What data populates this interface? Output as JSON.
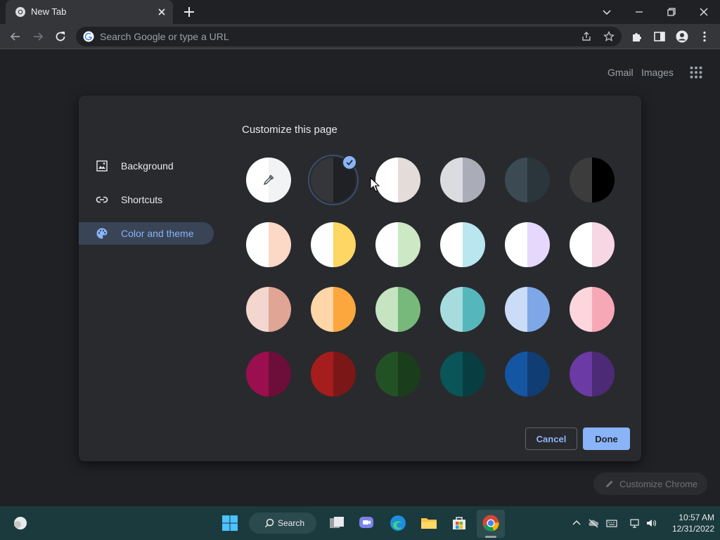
{
  "browser": {
    "tab_title": "New Tab",
    "omnibox_placeholder": "Search Google or type a URL"
  },
  "ntp": {
    "gmail_label": "Gmail",
    "images_label": "Images",
    "customize_chrome_label": "Customize Chrome"
  },
  "dialog": {
    "title": "Customize this page",
    "sidebar": [
      {
        "label": "Background",
        "icon": "image-icon"
      },
      {
        "label": "Shortcuts",
        "icon": "link-icon"
      },
      {
        "label": "Color and theme",
        "icon": "palette-icon",
        "active": true
      }
    ],
    "selected_theme_index": 1,
    "themes": [
      {
        "name": "custom-color-picker",
        "left": "#ffffff",
        "right": "#f1f3f4"
      },
      {
        "name": "default-dark",
        "left": "#35363a",
        "right": "#202124"
      },
      {
        "name": "warm-grey",
        "left": "#ffffff",
        "right": "#e3dcd9"
      },
      {
        "name": "cool-grey",
        "left": "#dadce0",
        "right": "#aaadb7"
      },
      {
        "name": "dark-blue-grey",
        "left": "#3c4a54",
        "right": "#2a353c"
      },
      {
        "name": "black",
        "left": "#3c3c3c",
        "right": "#000000"
      },
      {
        "name": "beige-white",
        "left": "#ffffff",
        "right": "#fcd8c6"
      },
      {
        "name": "yellow-white",
        "left": "#ffffff",
        "right": "#fdd663"
      },
      {
        "name": "green-white",
        "left": "#ffffff",
        "right": "#cce8c4"
      },
      {
        "name": "light-teal-white",
        "left": "#ffffff",
        "right": "#b9e6ef"
      },
      {
        "name": "light-purple-white",
        "left": "#ffffff",
        "right": "#e5d8fc"
      },
      {
        "name": "pink-white",
        "left": "#ffffff",
        "right": "#f6d7e3"
      },
      {
        "name": "beige",
        "left": "#f3d7cf",
        "right": "#e0a594"
      },
      {
        "name": "orange",
        "left": "#fed6a7",
        "right": "#fba73e"
      },
      {
        "name": "light-green",
        "left": "#c6e4c2",
        "right": "#77b97a"
      },
      {
        "name": "light-teal",
        "left": "#a6dcdd",
        "right": "#55b7bc"
      },
      {
        "name": "light-blue",
        "left": "#cbdcf8",
        "right": "#7ea7e8"
      },
      {
        "name": "light-pink",
        "left": "#fcd6dc",
        "right": "#f7a8b7"
      },
      {
        "name": "dark-pink-red",
        "left": "#9b0f4f",
        "right": "#6d0d39"
      },
      {
        "name": "dark-red-orange",
        "left": "#a51d1d",
        "right": "#7c1717"
      },
      {
        "name": "dark-green",
        "left": "#225126",
        "right": "#1a3d1c"
      },
      {
        "name": "dark-teal",
        "left": "#0a5558",
        "right": "#083e41"
      },
      {
        "name": "dark-blue",
        "left": "#1556a3",
        "right": "#103d73"
      },
      {
        "name": "purple",
        "left": "#6b3aa4",
        "right": "#4c2a75"
      }
    ],
    "cancel_label": "Cancel",
    "done_label": "Done"
  },
  "taskbar": {
    "search_label": "Search",
    "time": "10:57 AM",
    "date": "12/31/2022"
  },
  "colors": {
    "accent": "#8ab4f8",
    "dialog_bg": "#292a2d",
    "page_bg": "#202124",
    "taskbar_bg": "#1b3a3d"
  }
}
